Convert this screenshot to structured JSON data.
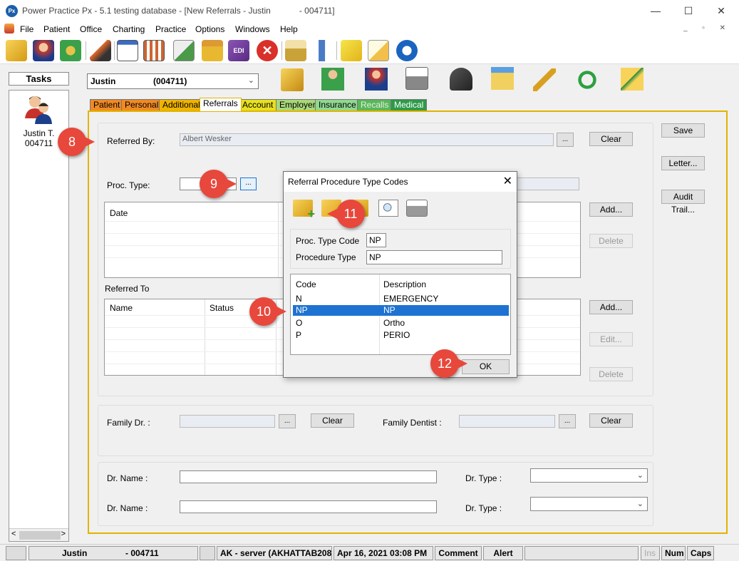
{
  "window": {
    "title": "Power Practice Px - 5.1 testing database - [New Referrals - Justin            - 004711]",
    "logo": "Px"
  },
  "menu": {
    "items": [
      "File",
      "Patient",
      "Office",
      "Charting",
      "Practice",
      "Options",
      "Windows",
      "Help"
    ]
  },
  "tasks": {
    "title": "Tasks",
    "patient_name": "Justin T.",
    "patient_id": "004711"
  },
  "patient_selector": {
    "name": "Justin",
    "id": "(004711)"
  },
  "tabs": [
    {
      "label": "Patient",
      "color": "#f08a24"
    },
    {
      "label": "Personal",
      "color": "#f08a24"
    },
    {
      "label": "Additional",
      "color": "#f0b400"
    },
    {
      "label": "Referrals",
      "color": "#ffffff"
    },
    {
      "label": "Account",
      "color": "#e8e020"
    },
    {
      "label": "Employer",
      "color": "#a8d878"
    },
    {
      "label": "Insurance",
      "color": "#90d890"
    },
    {
      "label": "Recalls",
      "color": "#58b858"
    },
    {
      "label": "Medical",
      "color": "#2e9a4a"
    }
  ],
  "referred_by": {
    "label": "Referred By:",
    "value": "Albert Wesker",
    "browse": "...",
    "clear": "Clear"
  },
  "proc_type": {
    "label": "Proc. Type:",
    "browse": "..."
  },
  "proc_list": {
    "col_date": "Date",
    "add": "Add...",
    "delete": "Delete"
  },
  "referred_to": {
    "label": "Referred To",
    "col_name": "Name",
    "col_status": "Status",
    "add": "Add...",
    "edit": "Edit...",
    "delete": "Delete"
  },
  "side_buttons": {
    "save": "Save",
    "letter": "Letter...",
    "audit": "Audit Trail..."
  },
  "family": {
    "dr_label": "Family Dr. :",
    "dentist_label": "Family Dentist :",
    "browse": "...",
    "clear": "Clear"
  },
  "doctors": {
    "name_label": "Dr. Name :",
    "type_label": "Dr. Type :"
  },
  "dialog": {
    "title": "Referral Procedure Type Codes",
    "code_label": "Proc. Type Code",
    "code_value": "NP",
    "type_label": "Procedure Type",
    "type_value": "NP",
    "col_code": "Code",
    "col_desc": "Description",
    "rows": [
      {
        "code": "N",
        "desc": "EMERGENCY"
      },
      {
        "code": "NP",
        "desc": "NP"
      },
      {
        "code": "O",
        "desc": "Ortho"
      },
      {
        "code": "P",
        "desc": "PERIO"
      }
    ],
    "ok": "OK",
    "selected_color": "#1e73d2"
  },
  "callouts": [
    "8",
    "9",
    "10",
    "11",
    "12"
  ],
  "statusbar": {
    "patient": "Justin",
    "patient_id": "- 004711",
    "server": "AK - server (AKHATTAB208",
    "datetime": "Apr 16, 2021 03:08 PM",
    "comment": "Comment",
    "alert": "Alert",
    "ins": "Ins",
    "num": "Num",
    "caps": "Caps"
  }
}
